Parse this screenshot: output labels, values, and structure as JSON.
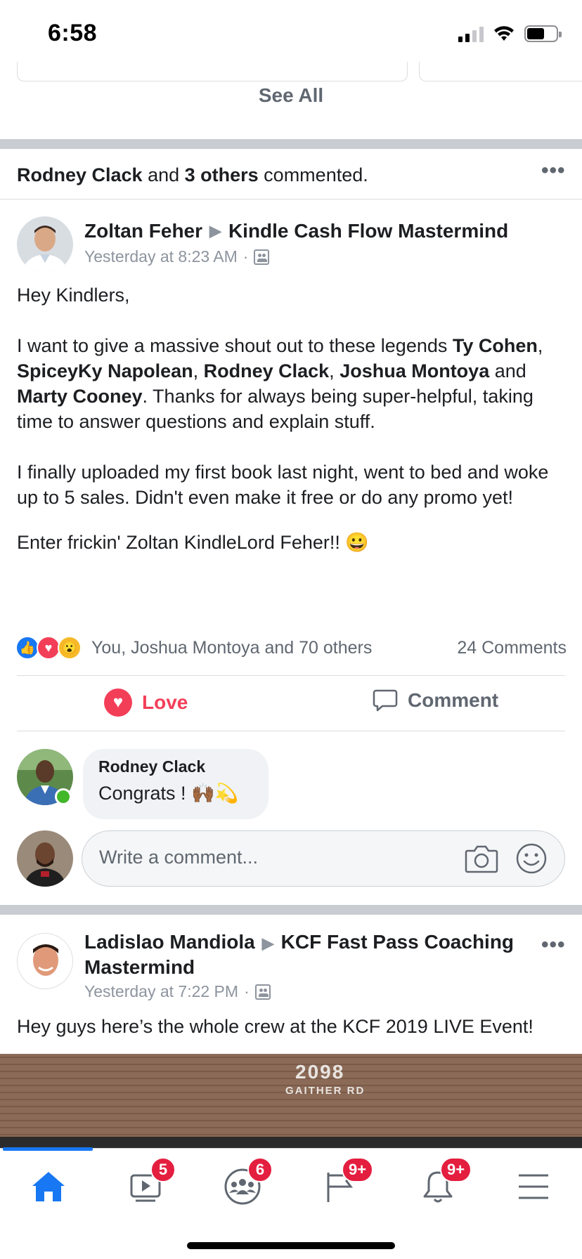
{
  "status_bar": {
    "time": "6:58"
  },
  "top_section": {
    "see_all": "See All"
  },
  "activity": {
    "actor": "Rodney Clack",
    "and": " and ",
    "others": "3 others",
    "action": " commented."
  },
  "post1": {
    "author": "Zoltan Feher",
    "group": "Kindle Cash Flow Mastermind",
    "time": "Yesterday at 8:23 AM",
    "dot": "·",
    "greeting": "Hey Kindlers,",
    "p2_a": "I want to give a massive shout out to these legends ",
    "name1": "Ty Cohen",
    "sep1": ", ",
    "name2": "SpiceyKy Napolean",
    "sep2": ", ",
    "name3": "Rodney Clack",
    "sep3": ", ",
    "name4": "Joshua Montoya",
    "sep4": " and ",
    "name5": "Marty Cooney",
    "p2_b": ". Thanks for always being super-helpful, taking time to answer questions and explain stuff.",
    "p3": "I finally uploaded my first book last night, went to bed and woke up to 5 sales. Didn't even make it free or do any promo yet!",
    "p4": "Enter frickin' Zoltan KindleLord Feher!! 😀",
    "reactions_summary": "You, Joshua Montoya and 70 others",
    "comments_count": "24 Comments",
    "love_label": "Love",
    "comment_label": "Comment"
  },
  "comment": {
    "author": "Rodney Clack",
    "text": "Congrats ! 🙌🏾💫"
  },
  "composer": {
    "placeholder": "Write a comment..."
  },
  "post2": {
    "author": "Ladislao Mandiola",
    "group": "KCF Fast Pass Coaching Mastermind",
    "time": "Yesterday at 7:22 PM",
    "dot": "·",
    "text": "Hey guys here’s the whole crew at the KCF 2019 LIVE Event!",
    "photo_number": "2098",
    "photo_road": "GAITHER RD"
  },
  "tab_bar": {
    "tabs": [
      {
        "icon": "home-icon",
        "badge": ""
      },
      {
        "icon": "watch-icon",
        "badge": "5"
      },
      {
        "icon": "groups-icon",
        "badge": "6"
      },
      {
        "icon": "pages-flag-icon",
        "badge": "9+"
      },
      {
        "icon": "notifications-bell-icon",
        "badge": "9+"
      },
      {
        "icon": "menu-icon",
        "badge": ""
      }
    ]
  },
  "colors": {
    "brand_blue": "#1877f2",
    "love_red": "#f33e58",
    "badge_red": "#e41e3f",
    "secondary_text": "#606770"
  }
}
